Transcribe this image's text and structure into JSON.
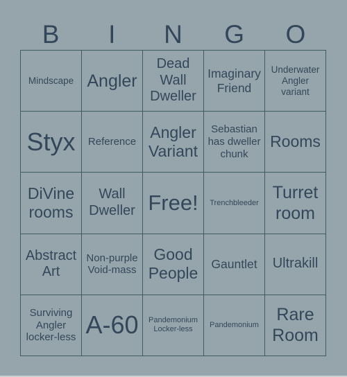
{
  "header": {
    "letters": [
      "B",
      "I",
      "N",
      "G",
      "O"
    ]
  },
  "cells": [
    [
      "Mindscape",
      "Angler",
      "Dead Wall Dweller",
      "Imaginary Friend",
      "Underwater Angler variant"
    ],
    [
      "Styx",
      "Reference",
      "Angler Variant",
      "Sebastian has dweller chunk",
      "Rooms"
    ],
    [
      "DiVine rooms",
      "Wall Dweller",
      "Free!",
      "Trenchbleeder",
      "Turret room"
    ],
    [
      "Abstract Art",
      "Non-purple Void-mass",
      "Good People",
      "Gauntlet",
      "Ultrakill"
    ],
    [
      "Surviving Angler locker-less",
      "A-60",
      "Pandemonium Locker-less",
      "Pandemonium",
      "Rare Room"
    ]
  ],
  "colors": {
    "background": "#96a5ab",
    "text": "#34475a",
    "grid_lines": "#3f5a61"
  }
}
